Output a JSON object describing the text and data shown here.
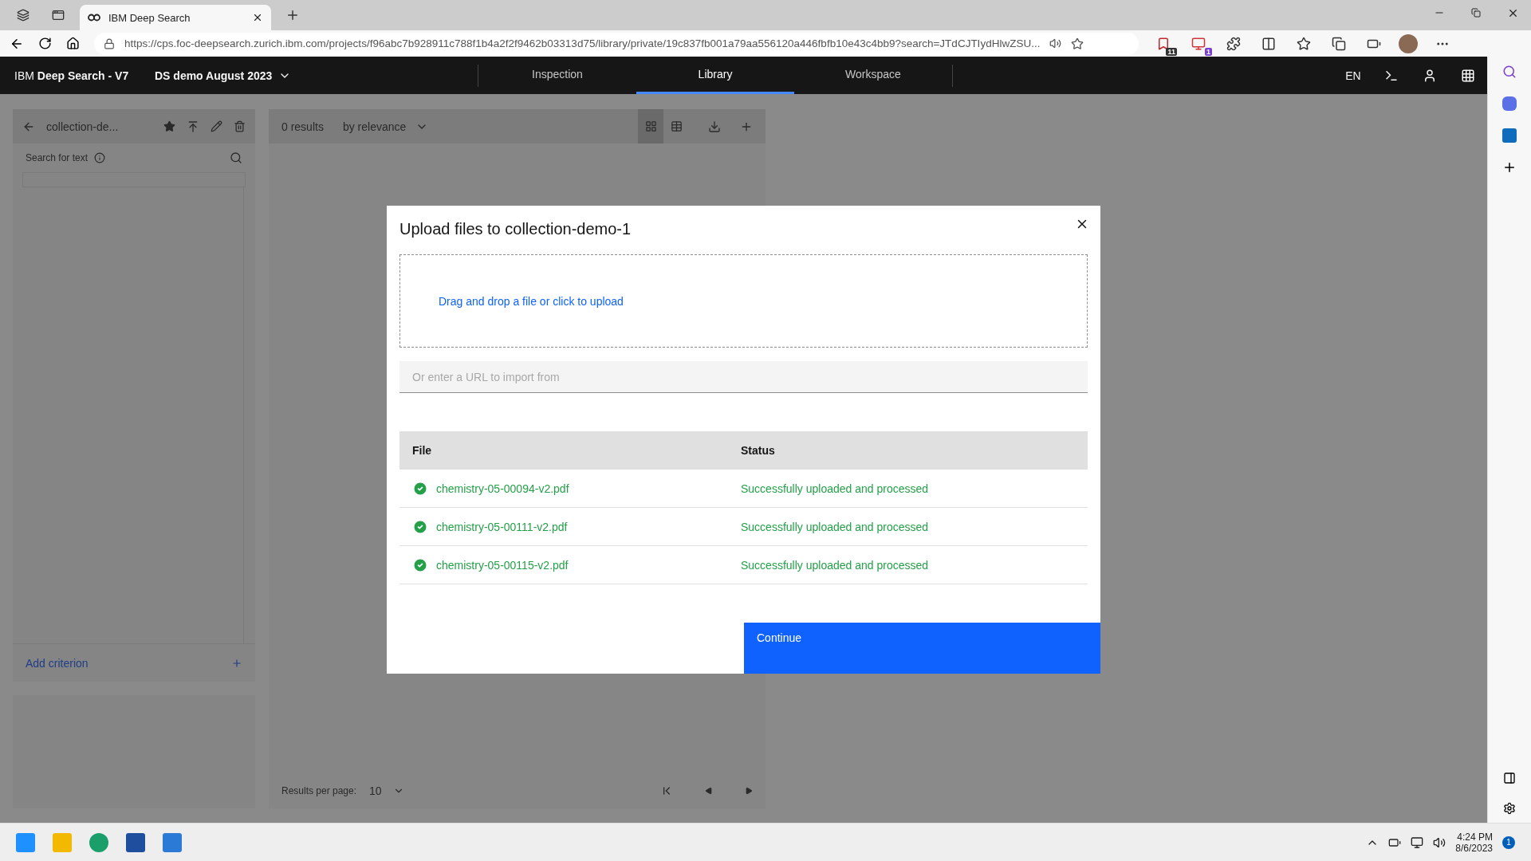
{
  "browser": {
    "tabs": [
      {
        "title": "IBM Deep Search",
        "selected": true
      }
    ],
    "url": "https://cps.foc-deepsearch.zurich.ibm.com/projects/f96abc7b928911c788f1b4a2f2f9462b03313d75/library/private/19c837fb001a79aa556120a446fbfb10e43c4bb9?search=JTdCJTIydHlwZSU...",
    "extension_badges": [
      "11",
      "1"
    ]
  },
  "app_header": {
    "brand": "IBM **Deep Search - V7**",
    "project": "DS demo August 2023",
    "nav": [
      {
        "label": "Inspection",
        "selected": false
      },
      {
        "label": "Library",
        "selected": true
      },
      {
        "label": "Workspace",
        "selected": false
      }
    ],
    "language": "EN"
  },
  "filter_panel": {
    "collection": "collection-de...",
    "search_label": "Search for text",
    "add_criterion": "Add criterion"
  },
  "results_panel": {
    "count": "0 results",
    "sort": "by relevance",
    "views": [
      {
        "kind": "grid",
        "selected": true
      },
      {
        "kind": "table",
        "selected": false
      }
    ],
    "per_page_label": "Results per page:",
    "per_page": "10"
  },
  "dialog": {
    "title": "Upload files to collection-demo-1",
    "dropzone": "Drag and drop a file or click to upload",
    "url_field": {
      "placeholder": "Or enter a URL to import from"
    },
    "columns": [
      "File",
      "Status"
    ],
    "rows": [
      {
        "file": "chemistry-05-00094-v2.pdf",
        "status": "Successfully uploaded and processed"
      },
      {
        "file": "chemistry-05-00111-v2.pdf",
        "status": "Successfully uploaded and processed"
      },
      {
        "file": "chemistry-05-00115-v2.pdf",
        "status": "Successfully uploaded and processed"
      }
    ],
    "button": "Continue"
  },
  "taskbar": {
    "time": "4:24 PM",
    "date": "8/6/2023",
    "notifications": "1"
  }
}
